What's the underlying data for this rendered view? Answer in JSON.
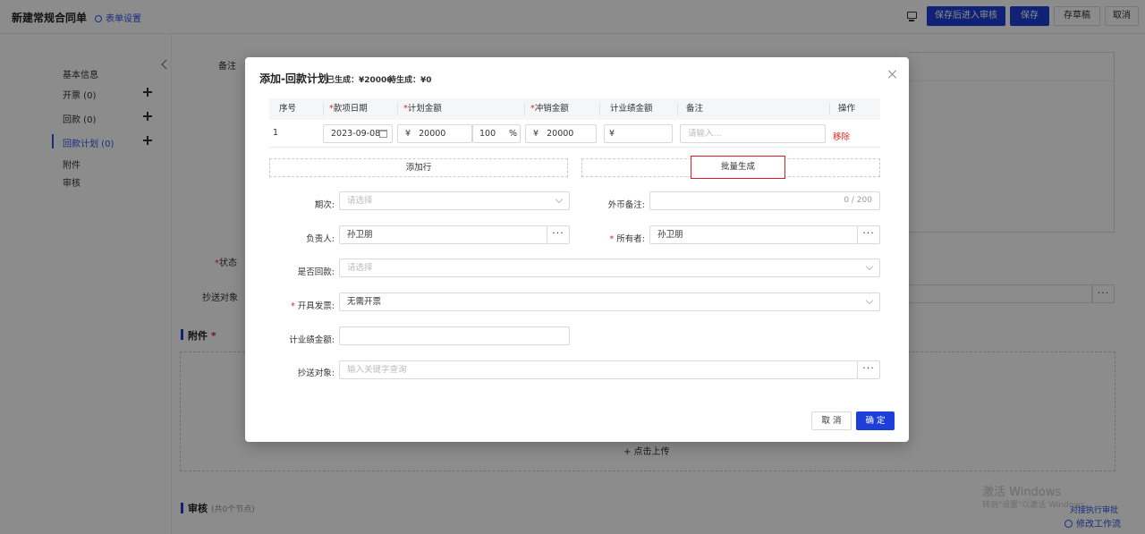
{
  "header": {
    "title": "新建常规合同单",
    "form_setting": "表单设置",
    "save_submit": "保存后进入审核",
    "save": "保存",
    "draft": "存草稿",
    "cancel": "取消"
  },
  "sidebar": {
    "items": [
      {
        "label": "基本信息"
      },
      {
        "label": "开票  (0)"
      },
      {
        "label": "回款  (0)"
      },
      {
        "label": "回款计划  (0)"
      },
      {
        "label": "附件"
      },
      {
        "label": "审核"
      }
    ]
  },
  "background": {
    "remark_label": "备注",
    "status_label": "状态",
    "cc_label": "抄送对象",
    "attachment_title": "附件",
    "upload_text": "+ 点击上传",
    "audit_title": "审核",
    "audit_sub": "(共0个节点)",
    "watermark_line1": "激活 Windows",
    "watermark_line2": "转到\"设置\"以激活 Windows。",
    "workflow_link1": "对接执行审批",
    "workflow_link2": "修改工作流"
  },
  "modal": {
    "title": "添加-回款计划",
    "generated": "已生成：¥20000",
    "pending": "待生成：¥0",
    "columns": [
      "序号",
      "款项日期",
      "计划金额",
      "冲销金额",
      "计业绩金额",
      "备注",
      "操作"
    ],
    "row": {
      "index": "1",
      "date": "2023-09-08",
      "currency": "¥",
      "plan_amount": "20000",
      "percent": "100",
      "percent_sign": "%",
      "offset_amount": "20000",
      "perf_amount": "",
      "remark_placeholder": "请输入...",
      "remove": "移除"
    },
    "add_row": "添加行",
    "batch_generate": "批量生成",
    "fields": {
      "period_label": "期次:",
      "period_placeholder": "请选择",
      "fx_remark_label": "外币备注:",
      "fx_remark_counter": "0 / 200",
      "owner_label": "负责人:",
      "owner_value": "孙卫朋",
      "holder_label": "所有者:",
      "holder_value": "孙卫朋",
      "is_paid_label": "是否回款:",
      "is_paid_placeholder": "请选择",
      "invoice_label": "开具发票:",
      "invoice_value": "无需开票",
      "perf_label": "计业绩金额:",
      "cc_label": "抄送对象:",
      "cc_placeholder": "输入关键字查询"
    },
    "cancel": "取 消",
    "ok": "确 定"
  }
}
